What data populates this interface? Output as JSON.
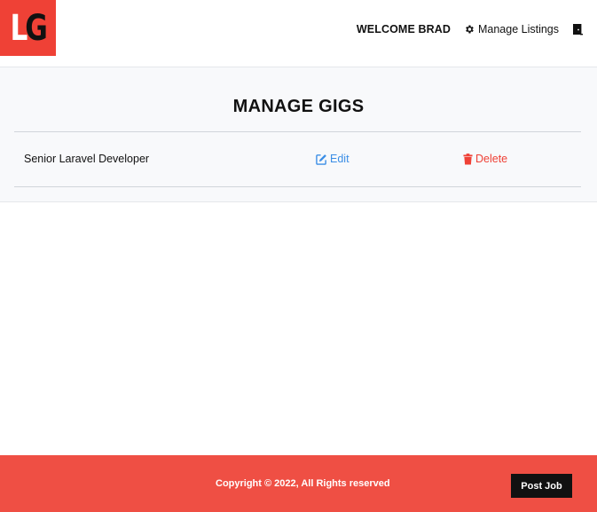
{
  "logo": {
    "letter_l": "L",
    "letter_g": "G"
  },
  "nav": {
    "welcome": "WELCOME BRAD",
    "manage_listings": "Manage Listings",
    "gear_icon": "gear-icon",
    "logout_icon": "door-exit-icon"
  },
  "main": {
    "title": "MANAGE GIGS",
    "gigs": [
      {
        "title": "Senior Laravel Developer",
        "edit_label": "Edit",
        "delete_label": "Delete"
      }
    ]
  },
  "footer": {
    "copyright": "Copyright © 2022, All Rights reserved",
    "post_job": "Post Job"
  },
  "colors": {
    "brand_red": "#ef4136",
    "edit_blue": "#3b8ee6",
    "footer_red": "#ef4f44",
    "button_black": "#111111"
  }
}
